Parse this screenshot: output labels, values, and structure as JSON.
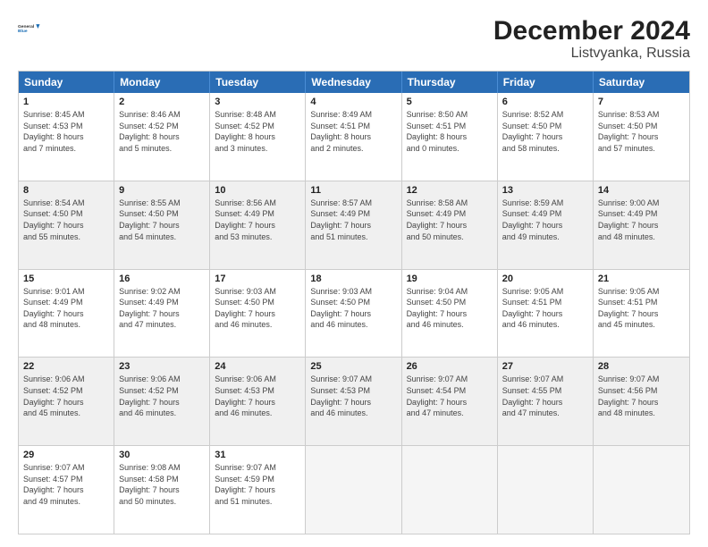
{
  "logo": {
    "line1": "General",
    "line2": "Blue"
  },
  "title": "December 2024",
  "subtitle": "Listvyanka, Russia",
  "days": [
    "Sunday",
    "Monday",
    "Tuesday",
    "Wednesday",
    "Thursday",
    "Friday",
    "Saturday"
  ],
  "weeks": [
    [
      {
        "day": "1",
        "info": "Sunrise: 8:45 AM\nSunset: 4:53 PM\nDaylight: 8 hours\nand 7 minutes."
      },
      {
        "day": "2",
        "info": "Sunrise: 8:46 AM\nSunset: 4:52 PM\nDaylight: 8 hours\nand 5 minutes."
      },
      {
        "day": "3",
        "info": "Sunrise: 8:48 AM\nSunset: 4:52 PM\nDaylight: 8 hours\nand 3 minutes."
      },
      {
        "day": "4",
        "info": "Sunrise: 8:49 AM\nSunset: 4:51 PM\nDaylight: 8 hours\nand 2 minutes."
      },
      {
        "day": "5",
        "info": "Sunrise: 8:50 AM\nSunset: 4:51 PM\nDaylight: 8 hours\nand 0 minutes."
      },
      {
        "day": "6",
        "info": "Sunrise: 8:52 AM\nSunset: 4:50 PM\nDaylight: 7 hours\nand 58 minutes."
      },
      {
        "day": "7",
        "info": "Sunrise: 8:53 AM\nSunset: 4:50 PM\nDaylight: 7 hours\nand 57 minutes."
      }
    ],
    [
      {
        "day": "8",
        "info": "Sunrise: 8:54 AM\nSunset: 4:50 PM\nDaylight: 7 hours\nand 55 minutes."
      },
      {
        "day": "9",
        "info": "Sunrise: 8:55 AM\nSunset: 4:50 PM\nDaylight: 7 hours\nand 54 minutes."
      },
      {
        "day": "10",
        "info": "Sunrise: 8:56 AM\nSunset: 4:49 PM\nDaylight: 7 hours\nand 53 minutes."
      },
      {
        "day": "11",
        "info": "Sunrise: 8:57 AM\nSunset: 4:49 PM\nDaylight: 7 hours\nand 51 minutes."
      },
      {
        "day": "12",
        "info": "Sunrise: 8:58 AM\nSunset: 4:49 PM\nDaylight: 7 hours\nand 50 minutes."
      },
      {
        "day": "13",
        "info": "Sunrise: 8:59 AM\nSunset: 4:49 PM\nDaylight: 7 hours\nand 49 minutes."
      },
      {
        "day": "14",
        "info": "Sunrise: 9:00 AM\nSunset: 4:49 PM\nDaylight: 7 hours\nand 48 minutes."
      }
    ],
    [
      {
        "day": "15",
        "info": "Sunrise: 9:01 AM\nSunset: 4:49 PM\nDaylight: 7 hours\nand 48 minutes."
      },
      {
        "day": "16",
        "info": "Sunrise: 9:02 AM\nSunset: 4:49 PM\nDaylight: 7 hours\nand 47 minutes."
      },
      {
        "day": "17",
        "info": "Sunrise: 9:03 AM\nSunset: 4:50 PM\nDaylight: 7 hours\nand 46 minutes."
      },
      {
        "day": "18",
        "info": "Sunrise: 9:03 AM\nSunset: 4:50 PM\nDaylight: 7 hours\nand 46 minutes."
      },
      {
        "day": "19",
        "info": "Sunrise: 9:04 AM\nSunset: 4:50 PM\nDaylight: 7 hours\nand 46 minutes."
      },
      {
        "day": "20",
        "info": "Sunrise: 9:05 AM\nSunset: 4:51 PM\nDaylight: 7 hours\nand 46 minutes."
      },
      {
        "day": "21",
        "info": "Sunrise: 9:05 AM\nSunset: 4:51 PM\nDaylight: 7 hours\nand 45 minutes."
      }
    ],
    [
      {
        "day": "22",
        "info": "Sunrise: 9:06 AM\nSunset: 4:52 PM\nDaylight: 7 hours\nand 45 minutes."
      },
      {
        "day": "23",
        "info": "Sunrise: 9:06 AM\nSunset: 4:52 PM\nDaylight: 7 hours\nand 46 minutes."
      },
      {
        "day": "24",
        "info": "Sunrise: 9:06 AM\nSunset: 4:53 PM\nDaylight: 7 hours\nand 46 minutes."
      },
      {
        "day": "25",
        "info": "Sunrise: 9:07 AM\nSunset: 4:53 PM\nDaylight: 7 hours\nand 46 minutes."
      },
      {
        "day": "26",
        "info": "Sunrise: 9:07 AM\nSunset: 4:54 PM\nDaylight: 7 hours\nand 47 minutes."
      },
      {
        "day": "27",
        "info": "Sunrise: 9:07 AM\nSunset: 4:55 PM\nDaylight: 7 hours\nand 47 minutes."
      },
      {
        "day": "28",
        "info": "Sunrise: 9:07 AM\nSunset: 4:56 PM\nDaylight: 7 hours\nand 48 minutes."
      }
    ],
    [
      {
        "day": "29",
        "info": "Sunrise: 9:07 AM\nSunset: 4:57 PM\nDaylight: 7 hours\nand 49 minutes."
      },
      {
        "day": "30",
        "info": "Sunrise: 9:08 AM\nSunset: 4:58 PM\nDaylight: 7 hours\nand 50 minutes."
      },
      {
        "day": "31",
        "info": "Sunrise: 9:07 AM\nSunset: 4:59 PM\nDaylight: 7 hours\nand 51 minutes."
      },
      {
        "day": "",
        "info": ""
      },
      {
        "day": "",
        "info": ""
      },
      {
        "day": "",
        "info": ""
      },
      {
        "day": "",
        "info": ""
      }
    ]
  ]
}
